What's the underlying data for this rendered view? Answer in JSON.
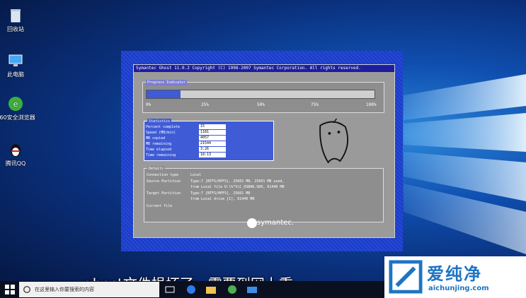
{
  "desktop_icons": [
    {
      "label": "回收站",
      "icon": "recycle-bin-icon"
    },
    {
      "label": "此电脑",
      "icon": "computer-icon"
    },
    {
      "label": "360安全浏览器",
      "icon": "browser-icon"
    },
    {
      "label": "腾讯QQ",
      "icon": "qq-penguin-icon"
    }
  ],
  "ghost": {
    "title": "Symantec Ghost 11.0.2   Copyright (C) 1998-2007 Symantec Corporation. All rights reserved.",
    "progress_label": "Progress Indicator",
    "progress_fraction": 0.15,
    "ticks": [
      "0%",
      "25%",
      "50%",
      "75%",
      "100%"
    ],
    "stats_label": "Statistics",
    "stats": [
      {
        "label": "Percent complete",
        "value": "15"
      },
      {
        "label": "Speed (MB/min)",
        "value": "1181"
      },
      {
        "label": "MB copied",
        "value": "4057"
      },
      {
        "label": "MB remaining",
        "value": "21544"
      },
      {
        "label": "Time elapsed",
        "value": "3:26"
      },
      {
        "label": "Time remaining",
        "value": "18:13"
      }
    ],
    "details_label": "Details",
    "details": [
      {
        "label": "Connection type",
        "lines": [
          "Local"
        ]
      },
      {
        "label": "Source Partition",
        "lines": [
          "Type:7 [NTFS/HPFS], 25601 MB, 25601 MB used,",
          "from Local file D:\\%^%\\C_OSBAK.GHO, 61440 MB"
        ]
      },
      {
        "label": "Target Partition",
        "lines": [
          "Type:7 [NTFS/HPFS], 25601 MB",
          "from Local drive [1], 61440 MB"
        ]
      },
      {
        "label": "Current file",
        "lines": [
          ""
        ]
      }
    ],
    "brand": "symantec."
  },
  "taskbar": {
    "search_placeholder": "在这里输入你要搜索的内容"
  },
  "subtitle": "ghost文件损坏了，需要到网上重",
  "watermark": {
    "name": "爱纯净",
    "url": "aichunjing.com"
  }
}
